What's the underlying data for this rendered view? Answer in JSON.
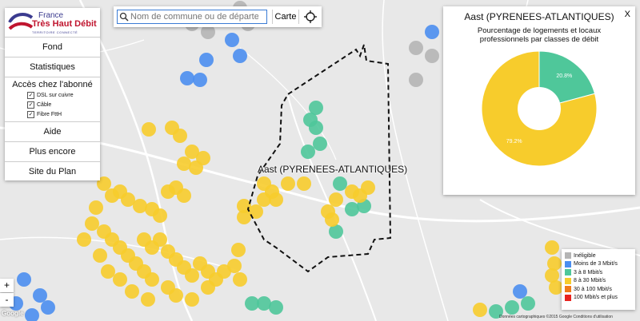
{
  "logo": {
    "line1": "France",
    "line2": "Très Haut Débit",
    "line3": "TERRITOIRE CONNECTÉ"
  },
  "sidebar": {
    "items_top": [
      {
        "label": "Fond"
      },
      {
        "label": "Statistiques"
      }
    ],
    "access_title": "Accès chez l'abonné",
    "checkboxes": [
      {
        "label": "DSL sur cuivre",
        "checked": true
      },
      {
        "label": "Câble",
        "checked": true
      },
      {
        "label": "Fibre FttH",
        "checked": true
      }
    ],
    "items_bottom": [
      {
        "label": "Aide"
      },
      {
        "label": "Plus encore"
      },
      {
        "label": "Site du Plan"
      }
    ]
  },
  "search": {
    "placeholder": "Nom de commune ou de département",
    "carte_label": "Carte",
    "locate_icon": "crosshair-icon"
  },
  "map": {
    "commune_label": "Aast (PYRENEES-ATLANTIQUES)",
    "zoom_in": "+",
    "zoom_out": "-",
    "attribution": "Données cartographiques ©2015 Google    Conditions d'utilisation",
    "google": "Google"
  },
  "chart_panel": {
    "close": "X"
  },
  "chart_data": {
    "type": "pie",
    "title": "Aast (PYRENEES-ATLANTIQUES)",
    "subtitle": "Pourcentage de logements et locaux professionnels par classes de débit",
    "slices": [
      {
        "label": "8 à 30 Mbit/s",
        "value": 79.2,
        "display": "79.2%",
        "color": "#f7cc2c"
      },
      {
        "label": "3 à 8 Mbit/s",
        "value": 20.8,
        "display": "20.8%",
        "color": "#4fc79a"
      }
    ]
  },
  "legend": [
    {
      "label": "Inéligible",
      "color": "#b5b5b5"
    },
    {
      "label": "Moins de 3 Mbit/s",
      "color": "#4b8ef0"
    },
    {
      "label": "3 à 8 Mbit/s",
      "color": "#4fc79a"
    },
    {
      "label": "8 à 30 Mbit/s",
      "color": "#f7cc2c"
    },
    {
      "label": "30 à 100 Mbit/s",
      "color": "#f07a1a"
    },
    {
      "label": "100 Mbit/s et plus",
      "color": "#e8231f"
    }
  ]
}
